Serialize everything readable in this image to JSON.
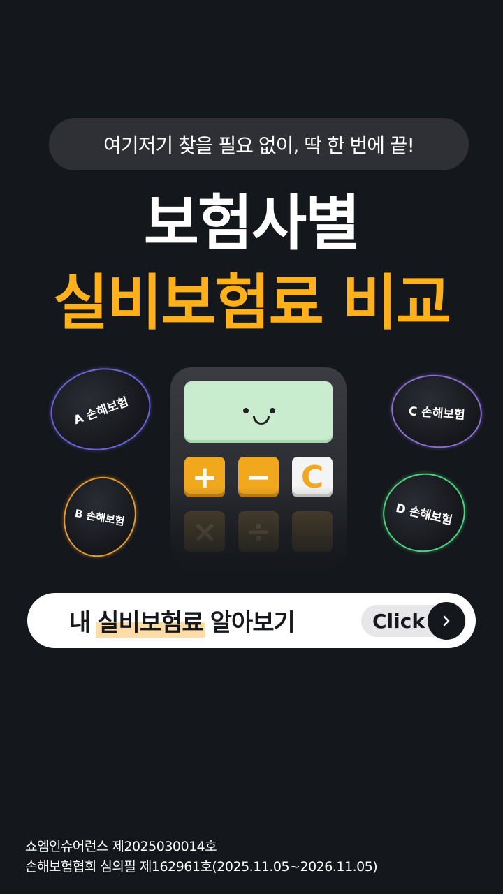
{
  "banner": {
    "top_text": "여기저기 찾을 필요 없이, 딱 한 번에 끝!",
    "title_line1": "보험사별",
    "title_line2": "실비보험료 비교"
  },
  "bubbles": [
    {
      "label": "A 손해보험",
      "color": "#6a63d8"
    },
    {
      "label": "B 손해보험",
      "color": "#e39a33"
    },
    {
      "label": "C 손해보험",
      "color": "#8a6ed0"
    },
    {
      "label": "D 손해보험",
      "color": "#4ed37d"
    }
  ],
  "calculator": {
    "keys": [
      "+",
      "−",
      "C",
      "×",
      "÷",
      ""
    ]
  },
  "cta": {
    "prefix": "내",
    "highlight": "실비보험료",
    "suffix": "알아보기",
    "click_label": "Click"
  },
  "footer": {
    "line1": "쇼엠인슈어런스 제2025030014호",
    "line2": "손해보험협회 심의필 제162961호(2025.11.05~2026.11.05)"
  },
  "colors": {
    "background": "#14171c",
    "accent": "#ffb01a",
    "highlight": "#ffdca6"
  }
}
